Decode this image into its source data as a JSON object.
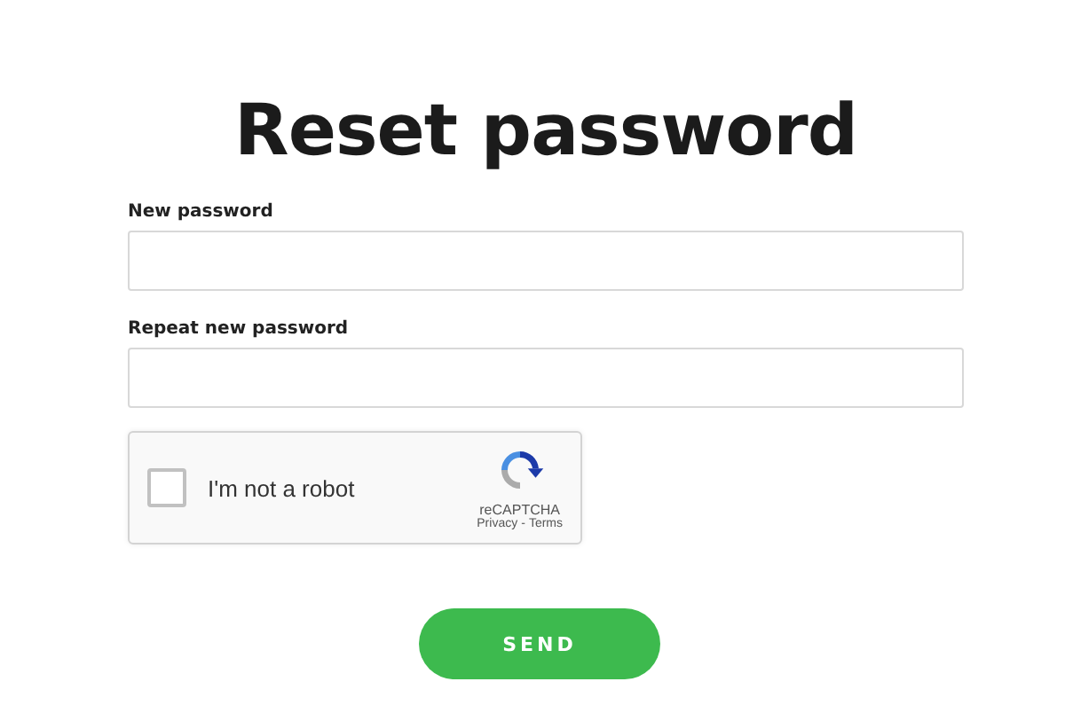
{
  "title": "Reset password",
  "fields": [
    {
      "label": "New password"
    },
    {
      "label": "Repeat new password"
    }
  ],
  "captcha": {
    "label": "I'm not a robot",
    "checked": false,
    "brand": "reCAPTCHA",
    "privacy": "Privacy",
    "separator": "-",
    "terms": "Terms"
  },
  "button": "SEND"
}
